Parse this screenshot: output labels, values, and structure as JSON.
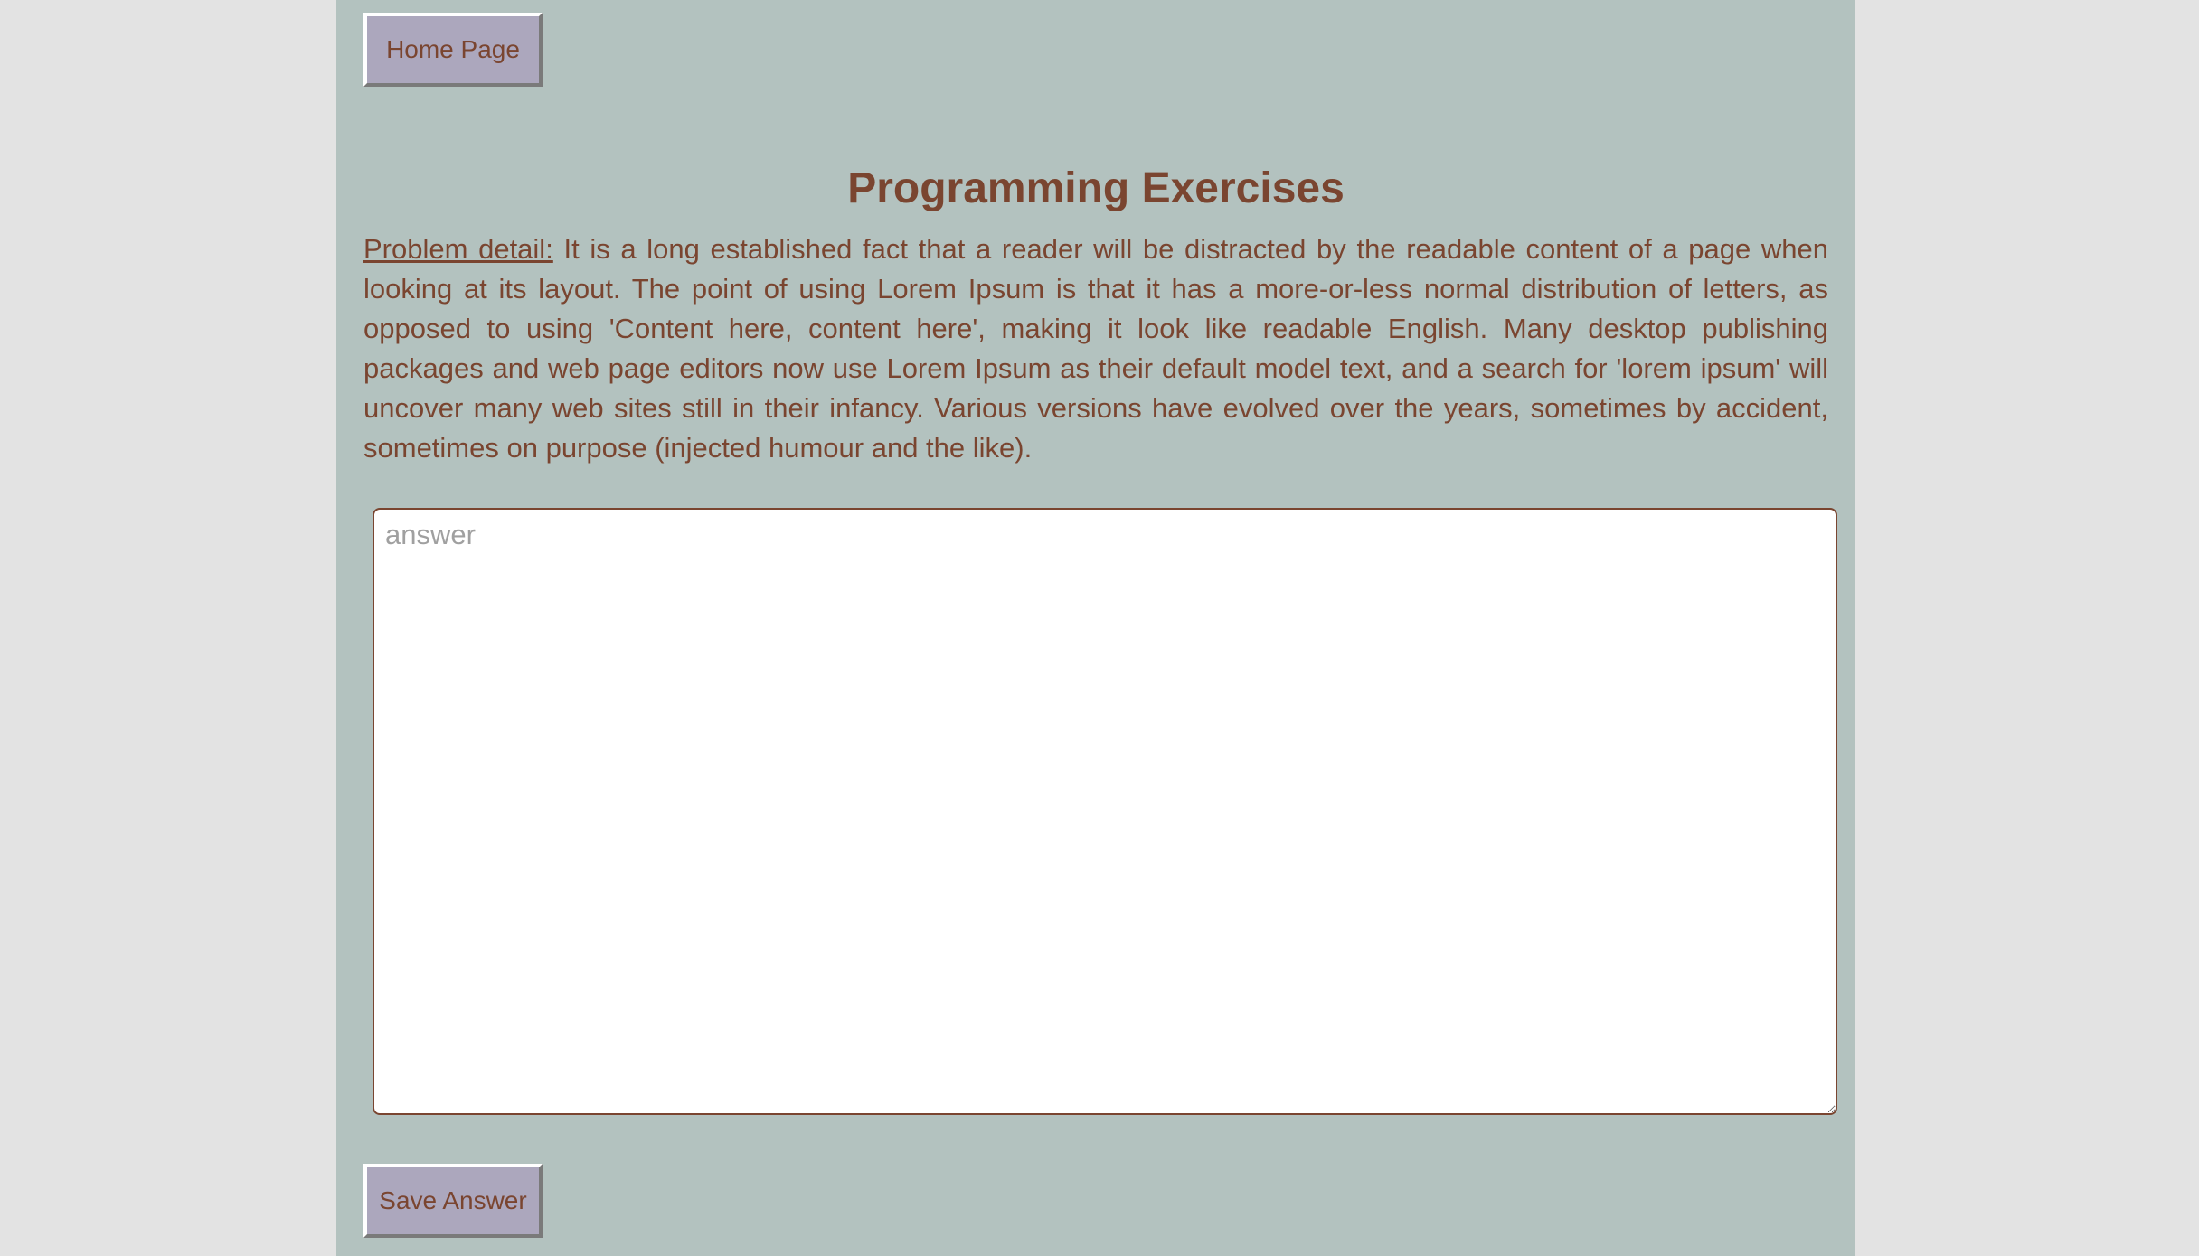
{
  "nav": {
    "home_label": "Home Page"
  },
  "main": {
    "title": "Programming Exercises",
    "problem_label": "Problem detail:",
    "problem_text": " It is a long established fact that a reader will be distracted by the readable content of a page when looking at its layout. The point of using Lorem Ipsum is that it has a more-or-less normal distribution of letters, as opposed to using 'Content here, content here', making it look like readable English. Many desktop publishing packages and web page editors now use Lorem Ipsum as their default model text, and a search for 'lorem ipsum' will uncover many web sites still in their infancy. Various versions have evolved over the years, sometimes by accident, sometimes on purpose (injected humour and the like).",
    "answer_placeholder": "answer",
    "answer_value": "",
    "save_label": "Save Answer"
  },
  "colors": {
    "page_background": "#e3e3e3",
    "content_background": "#b3c2bf",
    "text_brown": "#7a4530",
    "button_background": "#aca7bd"
  }
}
